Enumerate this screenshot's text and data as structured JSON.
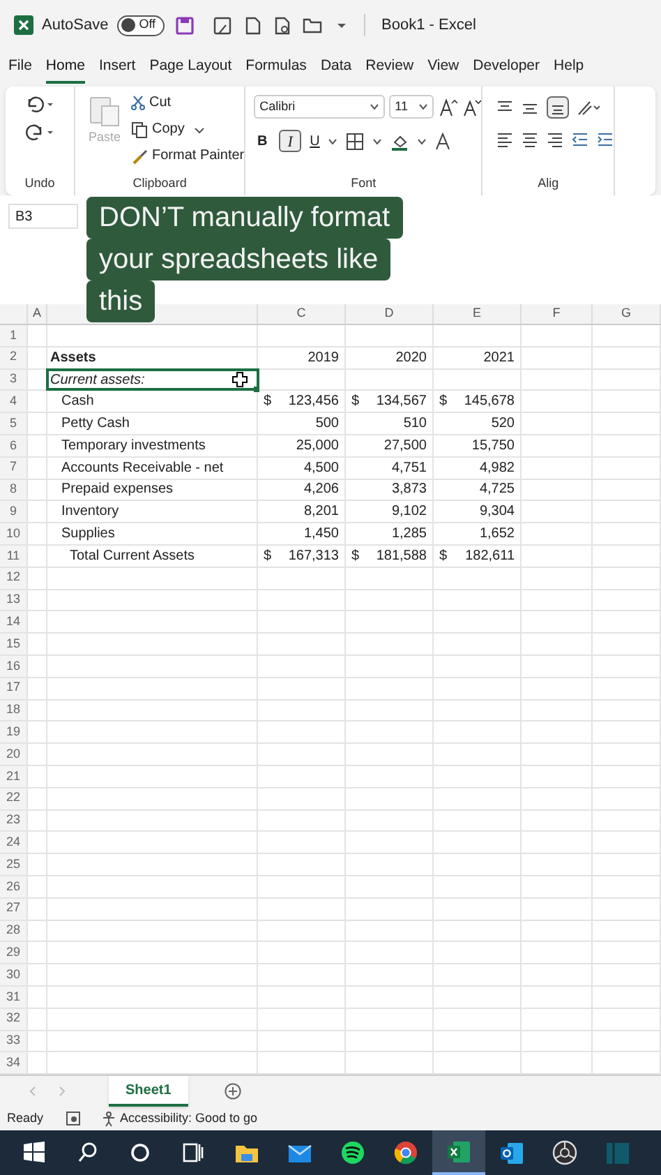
{
  "title_bar": {
    "autosave_label": "AutoSave",
    "autosave": {
      "on": false,
      "label": "Off"
    },
    "title": "Book1 - Excel"
  },
  "menu_tabs": [
    {
      "label": "File",
      "selected": false
    },
    {
      "label": "Home",
      "selected": true
    },
    {
      "label": "Insert",
      "selected": false
    },
    {
      "label": "Page Layout",
      "selected": false
    },
    {
      "label": "Formulas",
      "selected": false
    },
    {
      "label": "Data",
      "selected": false
    },
    {
      "label": "Review",
      "selected": false
    },
    {
      "label": "View",
      "selected": false
    },
    {
      "label": "Developer",
      "selected": false
    },
    {
      "label": "Help",
      "selected": false
    }
  ],
  "ribbon": {
    "undo": {
      "label": "Undo"
    },
    "clipboard": {
      "paste": "Paste",
      "cut": "Cut",
      "copy": "Copy",
      "format_painter": "Format Painter",
      "label": "Clipboard"
    },
    "font": {
      "font_name": "Calibri",
      "font_size": "11",
      "bold": "B",
      "italic": "I",
      "italic_on": true,
      "underline": "U",
      "label": "Font"
    },
    "alignment": {
      "label": "Alig"
    }
  },
  "name_box": "B3",
  "caption_lines": [
    "DON’T manually format",
    "your spreadsheets like",
    "this"
  ],
  "column_headers": [
    "A",
    "C",
    "D",
    "E",
    "F",
    "G"
  ],
  "rows": [
    {
      "number": "1"
    },
    {
      "number": "2",
      "kind": "header",
      "label": "Assets",
      "selected": false,
      "values": [
        {
          "amount": "2019"
        },
        {
          "amount": "2020"
        },
        {
          "amount": "2021"
        }
      ]
    },
    {
      "number": "3",
      "kind": "section",
      "label": "Current assets:",
      "selected": true
    },
    {
      "number": "4",
      "kind": "item",
      "label": "Cash",
      "selected": false,
      "values": [
        {
          "sign": "$",
          "amount": "123,456"
        },
        {
          "sign": "$",
          "amount": "134,567"
        },
        {
          "sign": "$",
          "amount": "145,678"
        }
      ]
    },
    {
      "number": "5",
      "kind": "item",
      "label": "Petty Cash",
      "selected": false,
      "values": [
        {
          "amount": "500"
        },
        {
          "amount": "510"
        },
        {
          "amount": "520"
        }
      ]
    },
    {
      "number": "6",
      "kind": "item",
      "label": "Temporary investments",
      "selected": false,
      "values": [
        {
          "amount": "25,000"
        },
        {
          "amount": "27,500"
        },
        {
          "amount": "15,750"
        }
      ]
    },
    {
      "number": "7",
      "kind": "item",
      "label": "Accounts Receivable - net",
      "selected": false,
      "values": [
        {
          "amount": "4,500"
        },
        {
          "amount": "4,751"
        },
        {
          "amount": "4,982"
        }
      ]
    },
    {
      "number": "8",
      "kind": "item",
      "label": "Prepaid expenses",
      "selected": false,
      "values": [
        {
          "amount": "4,206"
        },
        {
          "amount": "3,873"
        },
        {
          "amount": "4,725"
        }
      ]
    },
    {
      "number": "9",
      "kind": "item",
      "label": "Inventory",
      "selected": false,
      "values": [
        {
          "amount": "8,201"
        },
        {
          "amount": "9,102"
        },
        {
          "amount": "9,304"
        }
      ]
    },
    {
      "number": "10",
      "kind": "item",
      "label": "Supplies",
      "selected": false,
      "values": [
        {
          "amount": "1,450"
        },
        {
          "amount": "1,285"
        },
        {
          "amount": "1,652"
        }
      ]
    },
    {
      "number": "11",
      "kind": "total",
      "label": "Total Current Assets",
      "selected": false,
      "values": [
        {
          "sign": "$",
          "amount": "167,313"
        },
        {
          "sign": "$",
          "amount": "181,588"
        },
        {
          "sign": "$",
          "amount": "182,611"
        }
      ]
    },
    {
      "number": "12"
    },
    {
      "number": "13"
    },
    {
      "number": "14"
    },
    {
      "number": "15"
    },
    {
      "number": "16"
    },
    {
      "number": "17"
    },
    {
      "number": "18"
    },
    {
      "number": "19"
    },
    {
      "number": "20"
    },
    {
      "number": "21"
    },
    {
      "number": "22"
    },
    {
      "number": "23"
    },
    {
      "number": "24"
    },
    {
      "number": "25"
    },
    {
      "number": "26"
    },
    {
      "number": "27"
    },
    {
      "number": "28"
    },
    {
      "number": "29"
    },
    {
      "number": "30"
    },
    {
      "number": "31"
    },
    {
      "number": "32"
    },
    {
      "number": "33"
    },
    {
      "number": "34"
    }
  ],
  "sheet_tabs": [
    {
      "label": "Sheet1",
      "selected": true
    }
  ],
  "status_bar": {
    "ready": "Ready",
    "accessibility": "Accessibility: Good to go"
  },
  "taskbar": [
    {
      "kind": "start",
      "selected": false
    },
    {
      "kind": "search",
      "selected": false
    },
    {
      "kind": "cortana",
      "selected": false
    },
    {
      "kind": "taskview",
      "selected": false
    },
    {
      "kind": "folder",
      "selected": false
    },
    {
      "kind": "mail",
      "selected": false
    },
    {
      "kind": "music",
      "selected": false
    },
    {
      "kind": "browser",
      "selected": false
    },
    {
      "kind": "excel",
      "selected": true
    },
    {
      "kind": "outlook",
      "selected": false
    },
    {
      "kind": "recorder",
      "selected": false
    },
    {
      "kind": "panel",
      "selected": false
    }
  ]
}
